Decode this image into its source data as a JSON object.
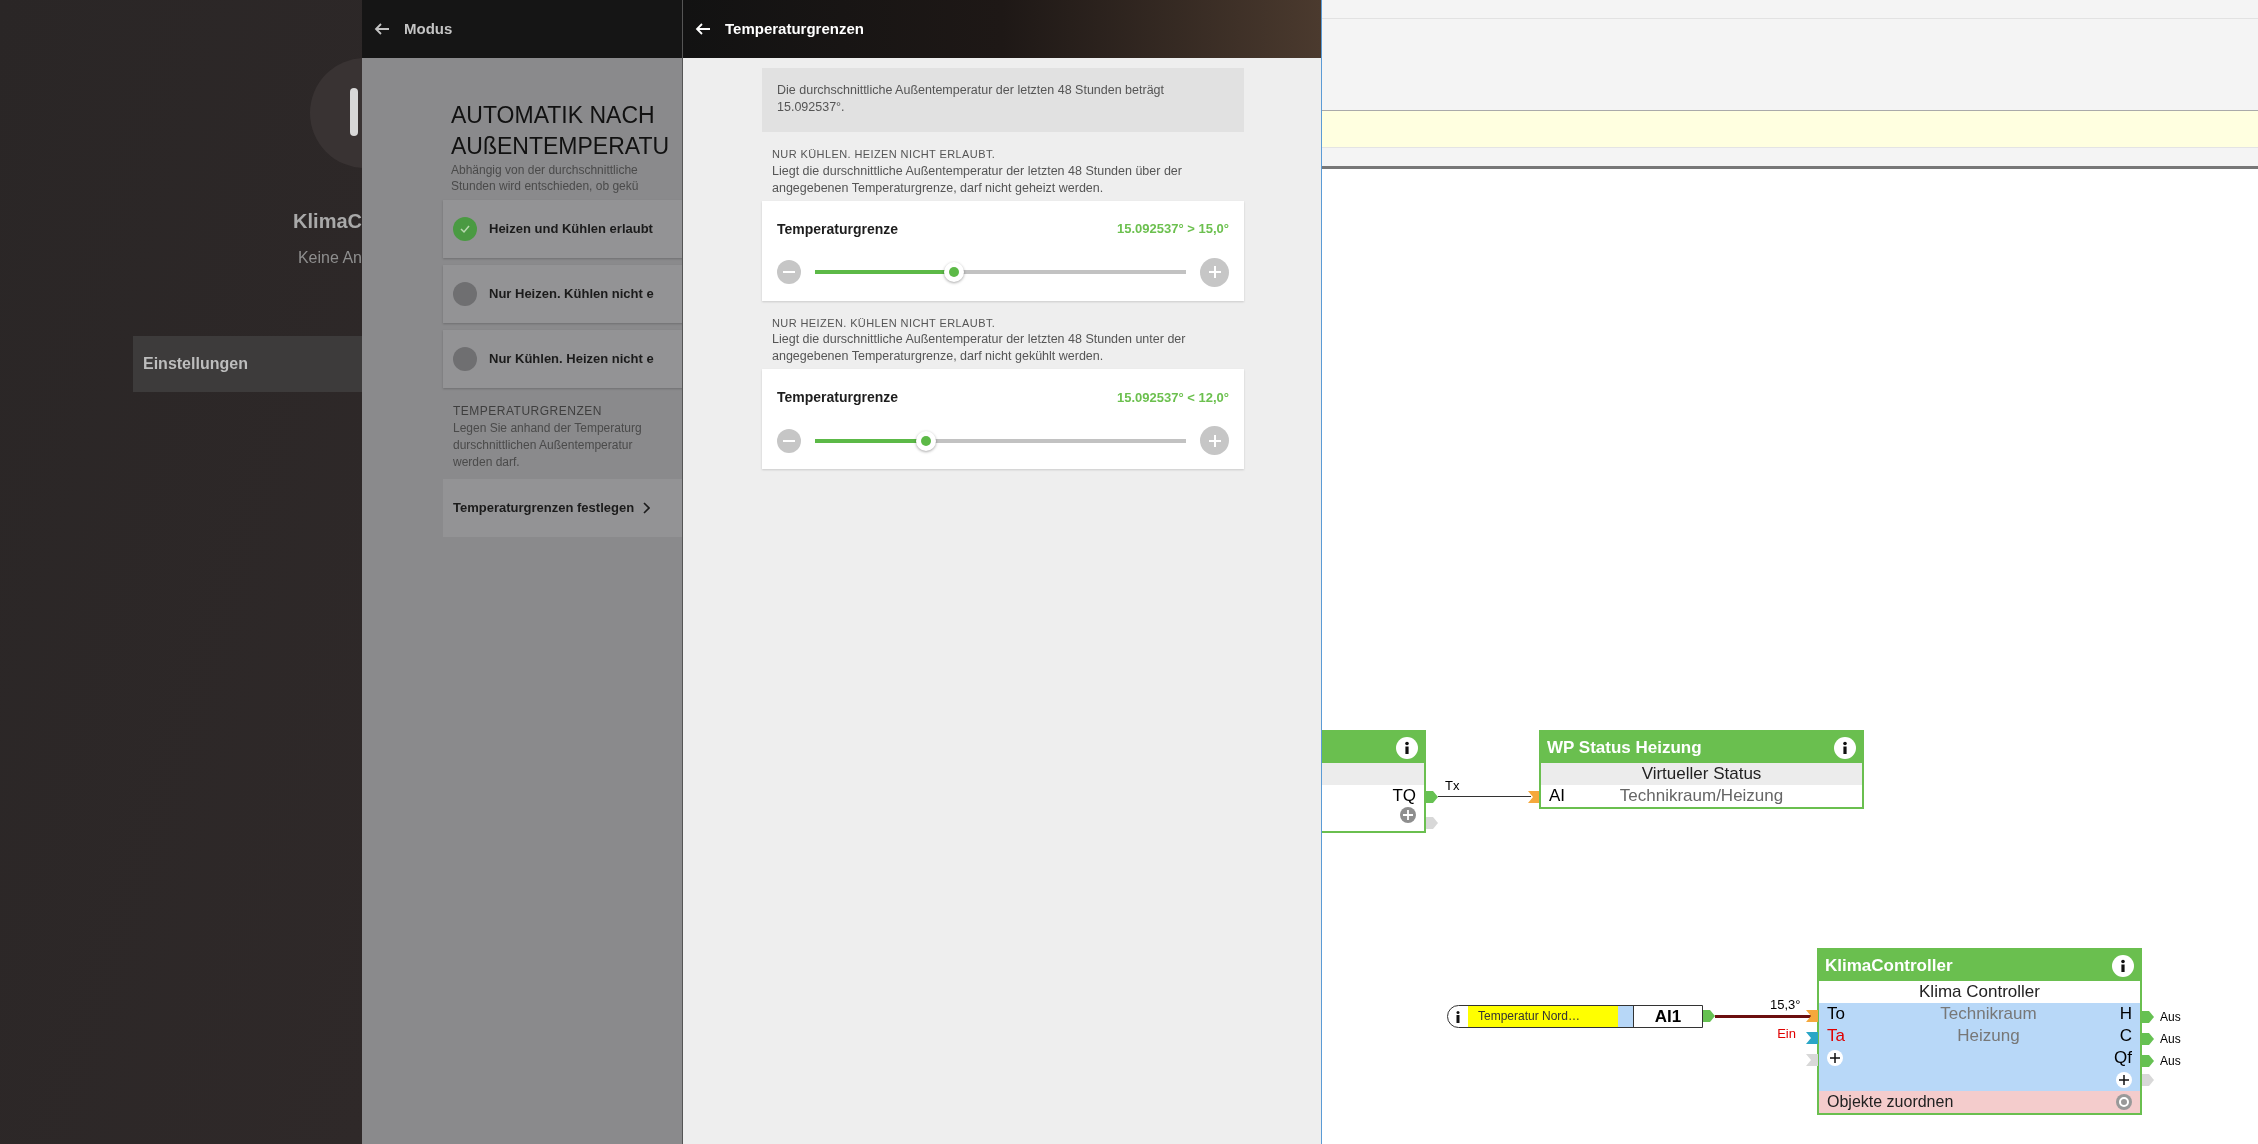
{
  "app": {
    "name": "KlimaC",
    "status": "Keine An",
    "menu_item": "Einstellungen"
  },
  "mode_panel": {
    "title": "Modus",
    "heading_lines": [
      "AUTOMATIK NACH",
      "AUßENTEMPERATU"
    ],
    "description_lines": [
      "Abhängig von der durchschnittliche",
      "Stunden wird entschieden, ob gekü"
    ],
    "options": [
      {
        "label": "Heizen und Kühlen erlaubt",
        "selected": true
      },
      {
        "label": "Nur Heizen. Kühlen nicht e",
        "selected": false
      },
      {
        "label": "Nur Kühlen. Heizen nicht e",
        "selected": false
      }
    ],
    "section_title": "TEMPERATURGRENZEN",
    "section_lines": [
      "Legen Sie anhand der Temperaturg",
      "durschnittlichen Außentemperatur",
      "werden darf."
    ],
    "link": "Temperaturgrenzen festlegen"
  },
  "limits_panel": {
    "title": "Temperaturgrenzen",
    "info": "Die durchschnittliche Außentemperatur der letzten 48 Stunden beträgt 15.092537°.",
    "limits": [
      {
        "heading": "NUR KÜHLEN. HEIZEN NICHT ERLAUBT.",
        "description": "Liegt die durschnittliche Außentemperatur der letzten 48 Stunden über der angegebenen Temperaturgrenze, darf nicht geheizt werden.",
        "label": "Temperaturgrenze",
        "reading": "15.092537° > 15,0°",
        "level": 0.375
      },
      {
        "heading": "NUR HEIZEN. KÜHLEN NICHT ERLAUBT.",
        "description": "Liegt die durschnittliche Außentemperatur der letzten 48 Stunden unter der angegebenen Temperaturgrenze, darf nicht gekühlt werden.",
        "label": "Temperaturgrenze",
        "reading": "15.092537° < 12,0°",
        "level": 0.3
      }
    ]
  },
  "editor": {
    "cut_block": {
      "output": "TQ",
      "wire_label": "Tx"
    },
    "status_block": {
      "title": "WP Status Heizung",
      "type": "Virtueller Status",
      "input": {
        "port": "AI",
        "value": "Technikraum/Heizung"
      }
    },
    "source": {
      "label": "Temperatur  Nord…",
      "port": "AI1",
      "wire_label": "15,3°"
    },
    "controller": {
      "title": "KlimaController",
      "type": "Klima Controller",
      "inputs": [
        {
          "port": "To",
          "value": "Technikraum",
          "color": "#000000"
        },
        {
          "port": "Ta",
          "value": "Heizung",
          "color": "#e00000",
          "wire_label": "Ein"
        }
      ],
      "outputs": [
        {
          "port": "H",
          "value": "Aus"
        },
        {
          "port": "C",
          "value": "Aus"
        },
        {
          "port": "Qf",
          "value": "Aus"
        }
      ],
      "footer": "Objekte zuordnen"
    }
  }
}
